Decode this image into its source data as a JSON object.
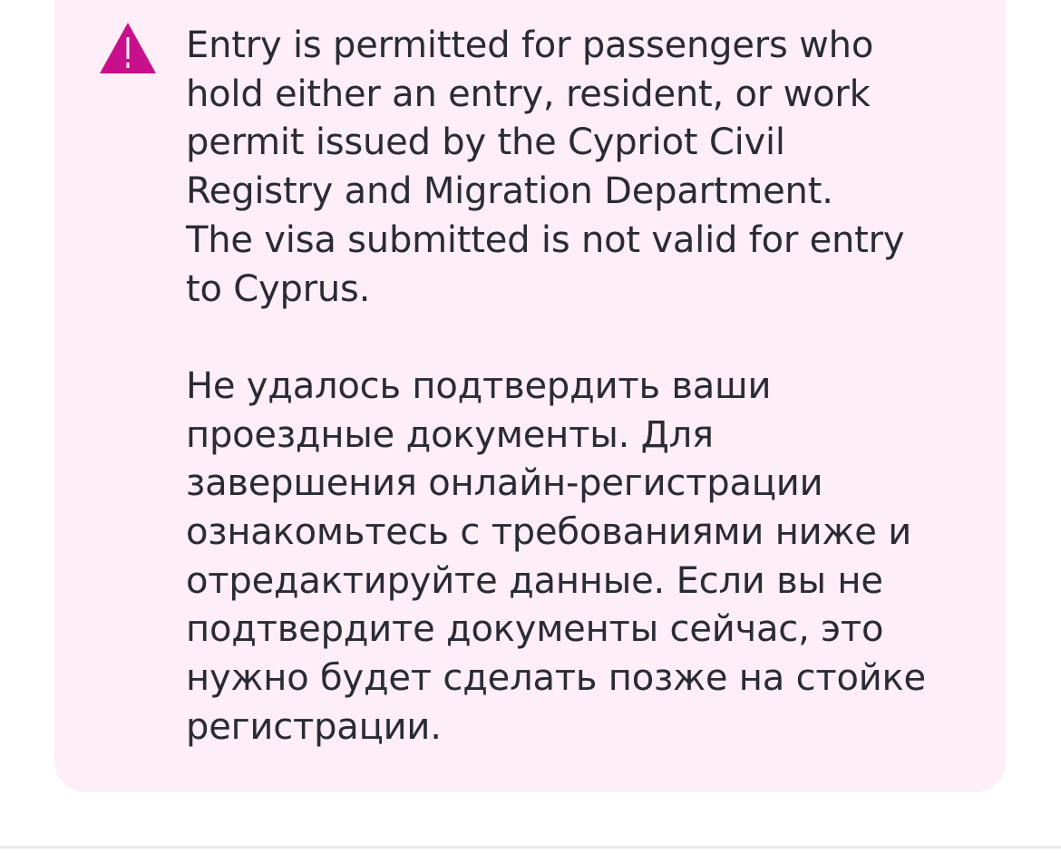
{
  "alert": {
    "icon": "warning-triangle-icon",
    "icon_color": "#c8108c",
    "background_color": "#fdeef7",
    "text_color": "#2b2b35",
    "message_en": "Entry is permitted for passengers who\nhold either an entry, resident, or work\npermit issued by the Cypriot Civil\nRegistry and Migration Department.\nThe visa submitted is not valid for entry\nto Cyprus.",
    "message_ru": "Не удалось подтвердить ваши\nпроездные документы. Для\nзавершения онлайн-регистрации\nознакомьтесь с требованиями ниже и\nотредактируйте данные. Если вы не\nподтвердите документы сейчас, это\nнужно будет сделать позже на стойке\nрегистрации."
  }
}
